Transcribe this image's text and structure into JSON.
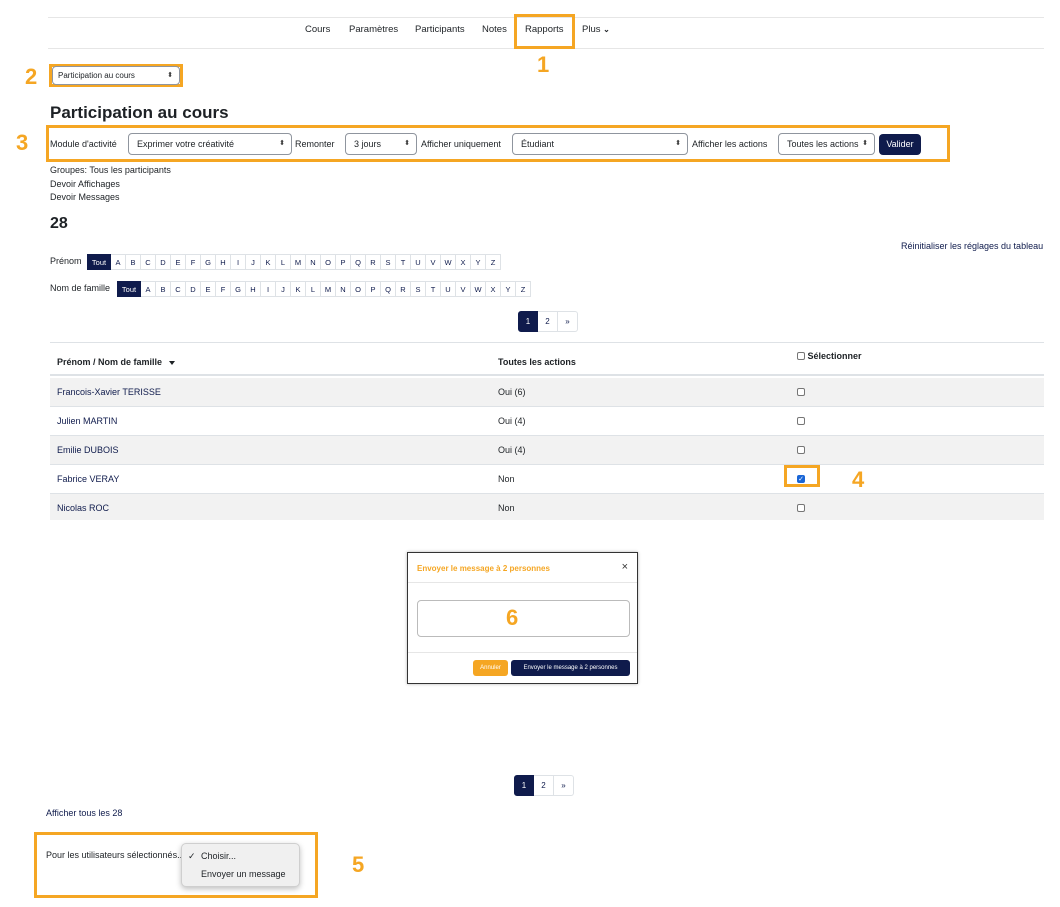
{
  "nav": {
    "items": [
      "Cours",
      "Paramètres",
      "Participants",
      "Notes",
      "Rapports",
      "Plus"
    ],
    "more_caret": "⌄"
  },
  "report_select": {
    "value": "Participation au cours"
  },
  "page_title": "Participation au cours",
  "filters": {
    "module_label": "Module d'activité",
    "module_value": "Exprimer votre créativité",
    "back_label": "Remonter",
    "back_value": "3 jours",
    "show_only_label": "Afficher uniquement",
    "show_only_value": "Étudiant",
    "show_actions_label": "Afficher les actions",
    "show_actions_value": "Toutes les actions",
    "submit_label": "Valider"
  },
  "info_lines": [
    "Groupes: Tous les participants",
    "Devoir Affichages",
    "Devoir Messages"
  ],
  "count": "28",
  "reset_link": "Réinitialiser les réglages du tableau",
  "firstname_filter": {
    "label": "Prénom",
    "all": "Tout"
  },
  "lastname_filter": {
    "label": "Nom de famille",
    "all": "Tout"
  },
  "letters": [
    "A",
    "B",
    "C",
    "D",
    "E",
    "F",
    "G",
    "H",
    "I",
    "J",
    "K",
    "L",
    "M",
    "N",
    "O",
    "P",
    "Q",
    "R",
    "S",
    "T",
    "U",
    "V",
    "W",
    "X",
    "Y",
    "Z"
  ],
  "pagination": {
    "pages": [
      "1",
      "2"
    ],
    "next": "»",
    "current": "1"
  },
  "table": {
    "col_name": "Prénom / Nom de famille",
    "sort_icon": "caret-down-icon",
    "col_actions": "Toutes les actions",
    "col_select": "Sélectionner",
    "rows": [
      {
        "name": "Francois-Xavier TERISSE",
        "actions": "Oui (6)",
        "checked": false
      },
      {
        "name": "Julien MARTIN",
        "actions": "Oui (4)",
        "checked": false
      },
      {
        "name": "Emilie DUBOIS",
        "actions": "Oui (4)",
        "checked": false
      },
      {
        "name": "Fabrice VERAY",
        "actions": "Non",
        "checked": true
      },
      {
        "name": "Nicolas ROC",
        "actions": "Non",
        "checked": false
      }
    ]
  },
  "modal": {
    "title": "Envoyer le message à 2 personnes",
    "close": "×",
    "cancel_label": "Annuler",
    "send_label": "Envoyer le message à 2 personnes"
  },
  "show_all_link": "Afficher tous les 28",
  "bulk": {
    "label": "Pour les utilisateurs sélectionnés...",
    "options": [
      "Choisir...",
      "Envoyer un message"
    ],
    "selected": "Choisir..."
  },
  "annotations": [
    "1",
    "2",
    "3",
    "4",
    "5",
    "6"
  ],
  "colors": {
    "accent": "#f5a623",
    "primary": "#0f1b4c",
    "checkbox": "#1a66d6"
  }
}
